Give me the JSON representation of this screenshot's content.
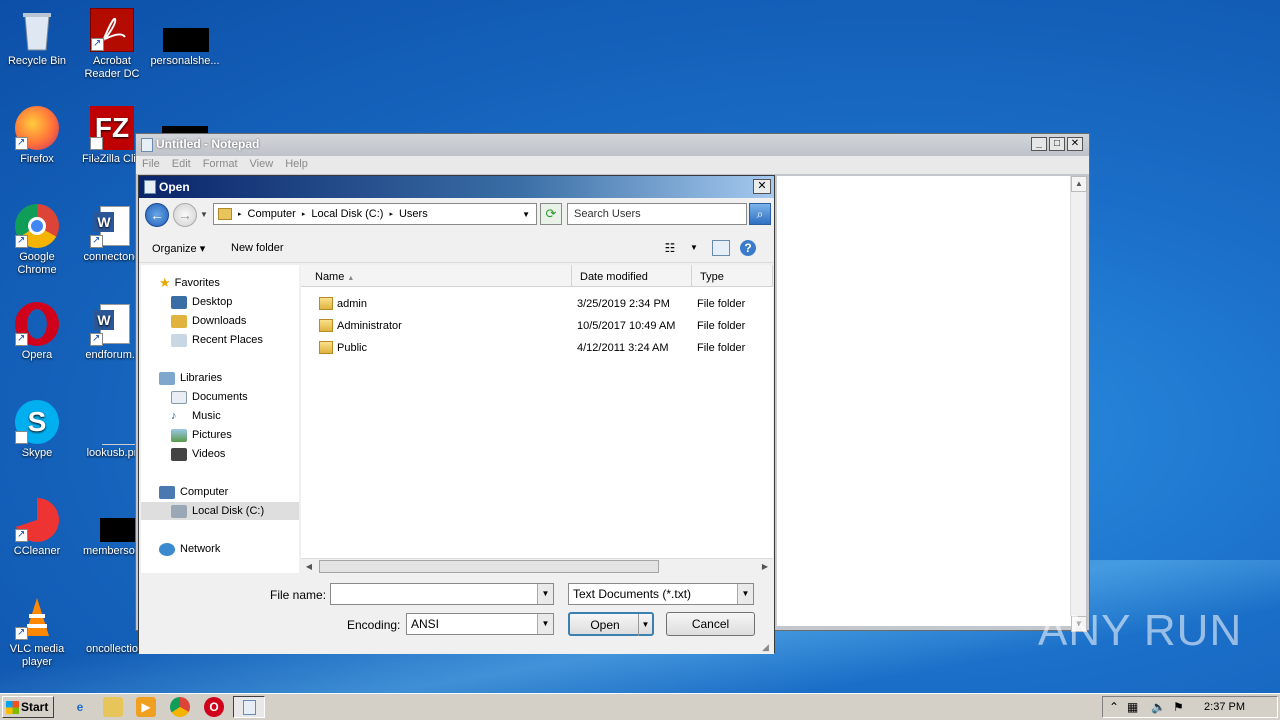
{
  "desktop": {
    "icons": [
      {
        "label": "Recycle Bin",
        "icon": "recycle-bin-icon"
      },
      {
        "label": "Acrobat Reader DC",
        "icon": "acrobat-icon"
      },
      {
        "label": "personalshe...",
        "icon": "redacted-icon"
      },
      {
        "label": "Firefox",
        "icon": "firefox-icon"
      },
      {
        "label": "FileZilla Clie",
        "icon": "filezilla-icon"
      },
      {
        "label": "Google Chrome",
        "icon": "chrome-icon"
      },
      {
        "label": "connectone",
        "icon": "word-doc-icon"
      },
      {
        "label": "Opera",
        "icon": "opera-icon"
      },
      {
        "label": "endforum.r",
        "icon": "word-doc-icon"
      },
      {
        "label": "Skype",
        "icon": "skype-icon"
      },
      {
        "label": "lookusb.pr",
        "icon": "file-icon"
      },
      {
        "label": "CCleaner",
        "icon": "ccleaner-icon"
      },
      {
        "label": "membersop",
        "icon": "redacted-icon"
      },
      {
        "label": "VLC media player",
        "icon": "vlc-icon"
      },
      {
        "label": "oncollectio",
        "icon": "file-icon"
      }
    ],
    "watermark": "ANY RUN"
  },
  "notepad": {
    "title": "Untitled - Notepad",
    "menu": [
      "File",
      "Edit",
      "Format",
      "View",
      "Help"
    ]
  },
  "dialog": {
    "title": "Open",
    "address": {
      "segments": [
        "Computer",
        "Local Disk (C:)",
        "Users"
      ]
    },
    "search_placeholder": "Search Users",
    "toolbar": {
      "organize": "Organize",
      "new_folder": "New folder"
    },
    "nav": {
      "favorites": "Favorites",
      "desktop": "Desktop",
      "downloads": "Downloads",
      "recent": "Recent Places",
      "libraries": "Libraries",
      "documents": "Documents",
      "music": "Music",
      "pictures": "Pictures",
      "videos": "Videos",
      "computer": "Computer",
      "local_disk": "Local Disk (C:)",
      "network": "Network"
    },
    "columns": {
      "name": "Name",
      "date": "Date modified",
      "type": "Type"
    },
    "files": [
      {
        "name": "admin",
        "date": "3/25/2019 2:34 PM",
        "type": "File folder"
      },
      {
        "name": "Administrator",
        "date": "10/5/2017 10:49 AM",
        "type": "File folder"
      },
      {
        "name": "Public",
        "date": "4/12/2011 3:24 AM",
        "type": "File folder"
      }
    ],
    "file_name_label": "File name:",
    "file_name_value": "",
    "file_type": "Text Documents (*.txt)",
    "encoding_label": "Encoding:",
    "encoding_value": "ANSI",
    "open_label": "Open",
    "cancel_label": "Cancel"
  },
  "taskbar": {
    "start_label": "Start",
    "clock": "2:37 PM"
  }
}
